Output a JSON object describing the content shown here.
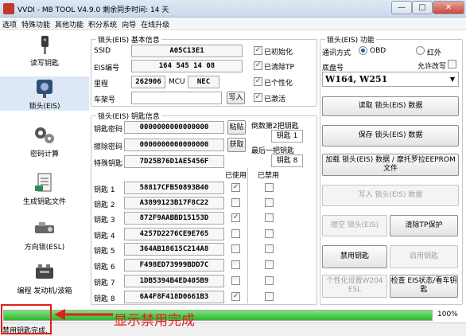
{
  "window": {
    "title": "VVDI - MB TOOL V4.9.0  剩余同步时间: 14 天",
    "minimize": "—",
    "maximize": "□",
    "close": "✕"
  },
  "menu": [
    "选项",
    "特殊功能",
    "其他功能",
    "积分系统",
    "向导",
    "在线升级"
  ],
  "sidebar": [
    {
      "label": "读写钥匙",
      "icon": "key-icon"
    },
    {
      "label": "锁头(EIS)",
      "icon": "eis-icon"
    },
    {
      "label": "密码计算",
      "icon": "gears-icon"
    },
    {
      "label": "生成钥匙文件",
      "icon": "document-icon"
    },
    {
      "label": "方向锁(ESL)",
      "icon": "steering-lock-icon"
    },
    {
      "label": "编程 发动机/波箱",
      "icon": "engine-icon"
    }
  ],
  "eis_basic": {
    "title": "锁头(EIS) 基本信息",
    "ssid_label": "SSID",
    "ssid": "A05C13E1",
    "eis_no_label": "EIS编号",
    "eis_no": "164 545 14 08",
    "mileage_label": "里程",
    "mileage": "262906",
    "mcu_label": "MCU",
    "mcu": "NEC",
    "vin_label": "车架号",
    "vin": "",
    "write_btn": "写入",
    "checks": [
      {
        "label": "已初始化",
        "checked": true
      },
      {
        "label": "已清除TP",
        "checked": true
      },
      {
        "label": "已个性化",
        "checked": true
      },
      {
        "label": "已激活",
        "checked": true
      }
    ]
  },
  "eis_keys": {
    "title": "锁头(EIS) 钥匙信息",
    "key_pass_label": "钥匙密码",
    "key_pass": "0000000000000000",
    "paste_btn": "粘贴",
    "erase_pass_label": "擦除密码",
    "erase_pass": "0000000000000000",
    "get_btn": "获取",
    "special_key_label": "特殊钥匙",
    "special_key": "7D25B76D1AE5456F",
    "second_last_label": "倒数第2把钥匙",
    "second_last_value": "钥匙 1",
    "last_label": "最后一把钥匙",
    "last_value": "钥匙 8",
    "used_header": "已使用",
    "disabled_header": "已禁用",
    "rows": [
      {
        "name": "钥匙 1",
        "hash": "58817CFB50893B40",
        "used": true,
        "disabled": false
      },
      {
        "name": "钥匙 2",
        "hash": "A3899123B17F8C22",
        "used": false,
        "disabled": false
      },
      {
        "name": "钥匙 3",
        "hash": "872F9AABBD15153D",
        "used": true,
        "disabled": false
      },
      {
        "name": "钥匙 4",
        "hash": "4257D2276CE9E765",
        "used": false,
        "disabled": false
      },
      {
        "name": "钥匙 5",
        "hash": "364AB18615C214A8",
        "used": false,
        "disabled": false
      },
      {
        "name": "钥匙 6",
        "hash": "F498ED73999BDD7C",
        "used": false,
        "disabled": false
      },
      {
        "name": "钥匙 7",
        "hash": "1DB5394B4ED405B9",
        "used": false,
        "disabled": false
      },
      {
        "name": "钥匙 8",
        "hash": "6A4F8F418D0661B3",
        "used": true,
        "disabled": false
      }
    ]
  },
  "eis_func": {
    "title": "锁头(EIS) 功能",
    "comm_label": "通讯方式",
    "obd_label": "OBD",
    "ir_label": "红外",
    "chassis_label": "底盘号",
    "allow_edit_label": "允许改写",
    "chassis_value": "W164, W251",
    "read_btn": "读取 锁头(EIS) 数据",
    "save_btn": "保存 锁头(EIS) 数据",
    "load_btn": "加载 锁头(EIS) 数据 / 摩托罗拉EEPROM文件",
    "write_btn": "写入 锁头(EIS) 数据",
    "erase_btn": "擦空 锁头(EIS)",
    "clear_tp_btn": "清除TP保护",
    "disable_key_btn": "禁用钥匙",
    "enable_key_btn": "启用钥匙",
    "personalize_btn": "个性化设置W204 ESL",
    "check_btn": "检查 EIS状态/看车钥匙"
  },
  "progress": {
    "value": 100,
    "label": "100%"
  },
  "status": "禁用钥匙完成.",
  "annotation": "显示禁用完成",
  "colors": {
    "annotation": "#e0201c",
    "progress": "#2fb52f"
  }
}
